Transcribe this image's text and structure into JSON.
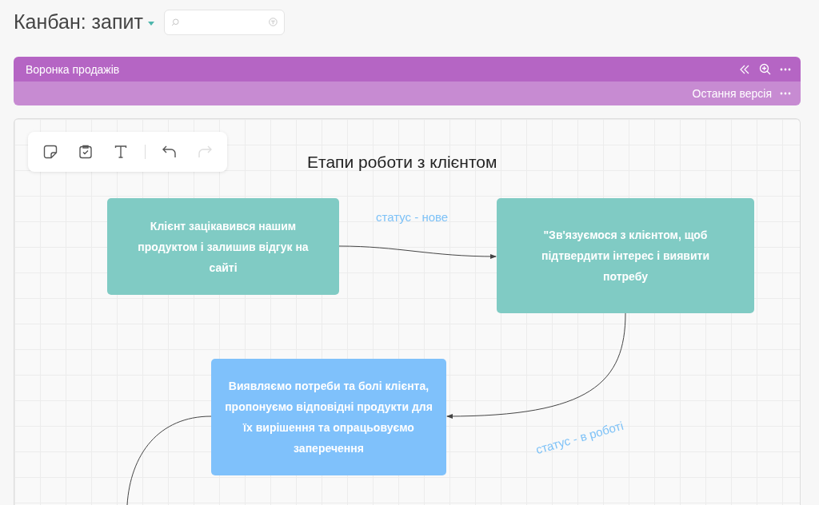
{
  "header": {
    "title": "Канбан: запит"
  },
  "board": {
    "title": "Воронка продажів",
    "version": "Остання версія"
  },
  "toolbar": [
    {
      "kind": "sticky",
      "disabled": false
    },
    {
      "kind": "task",
      "disabled": false
    },
    {
      "kind": "text",
      "disabled": false
    },
    {
      "kind": "undo",
      "disabled": false
    },
    {
      "kind": "redo",
      "disabled": true
    }
  ],
  "canvas": {
    "title": "Етапи роботи з клієнтом",
    "nodes": [
      {
        "text": "Клієнт зацікавився нашим продуктом і залишив відгук на сайті",
        "color": "#80cbc4"
      },
      {
        "text": "\"Зв'язуємося з клієнтом, щоб підтвердити інтерес і виявити потребу",
        "color": "#80cbc4"
      },
      {
        "text": "Виявляємо потреби та болі клієнта, пропонуємо відповідні продукти для їх вирішення та опрацьовуємо заперечення",
        "color": "#7fc1fb"
      }
    ],
    "labels": [
      "статус - нове",
      "статус - в роботі"
    ]
  }
}
